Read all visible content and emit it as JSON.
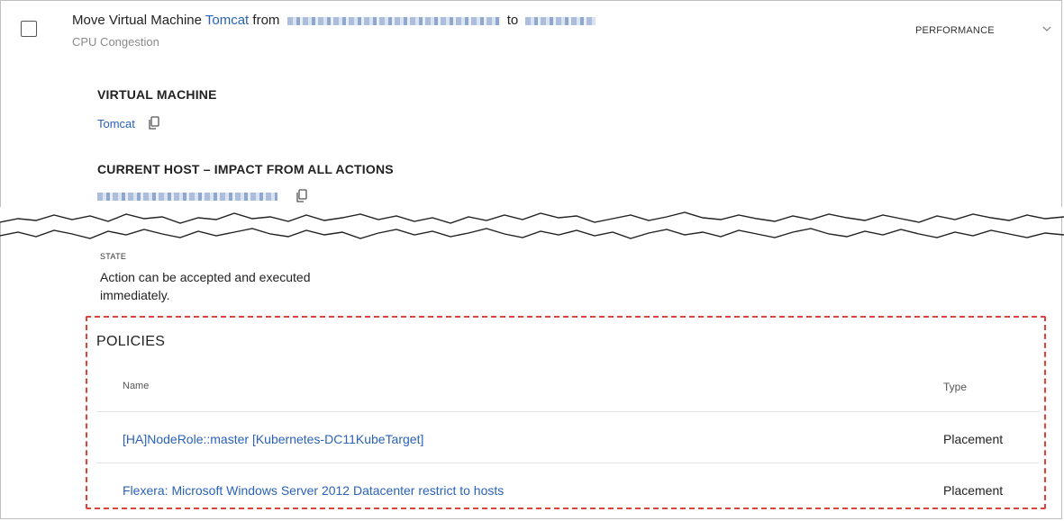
{
  "action": {
    "prefix": "Move Virtual Machine",
    "vm_name": "Tomcat",
    "from_label": "from",
    "to_label": "to",
    "subtitle": "CPU Congestion",
    "category": "PERFORMANCE"
  },
  "sections": {
    "virtual_machine": {
      "heading": "VIRTUAL MACHINE",
      "value": "Tomcat"
    },
    "current_host": {
      "heading": "CURRENT HOST – IMPACT FROM ALL ACTIONS"
    },
    "state": {
      "label": "STATE",
      "text": "Action can be accepted and executed immediately."
    }
  },
  "policies": {
    "title": "POLICIES",
    "columns": {
      "name": "Name",
      "type": "Type"
    },
    "rows": [
      {
        "name": "[HA]NodeRole::master [Kubernetes-DC11KubeTarget]",
        "type": "Placement"
      },
      {
        "name": "Flexera: Microsoft Windows Server 2012 Datacenter restrict to hosts",
        "type": "Placement"
      }
    ]
  },
  "colors": {
    "link": "#2a62b8",
    "highlight_border": "#e0413b"
  },
  "icons": {
    "copy": "copy-icon",
    "expand": "chevron-down-icon"
  }
}
